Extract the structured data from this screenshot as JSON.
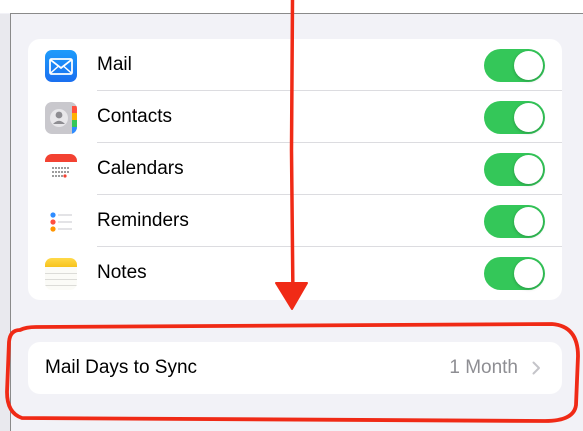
{
  "apps": {
    "items": [
      {
        "id": "mail",
        "label": "Mail",
        "enabled": true,
        "icon": "mail-icon"
      },
      {
        "id": "contacts",
        "label": "Contacts",
        "enabled": true,
        "icon": "contacts-icon"
      },
      {
        "id": "calendars",
        "label": "Calendars",
        "enabled": true,
        "icon": "calendar-icon"
      },
      {
        "id": "reminders",
        "label": "Reminders",
        "enabled": true,
        "icon": "reminders-icon"
      },
      {
        "id": "notes",
        "label": "Notes",
        "enabled": true,
        "icon": "notes-icon"
      }
    ]
  },
  "sync": {
    "label": "Mail Days to Sync",
    "value": "1 Month"
  },
  "colors": {
    "toggle_on": "#34c759",
    "annotation": "#f02a16",
    "background": "#f2f2f7"
  }
}
